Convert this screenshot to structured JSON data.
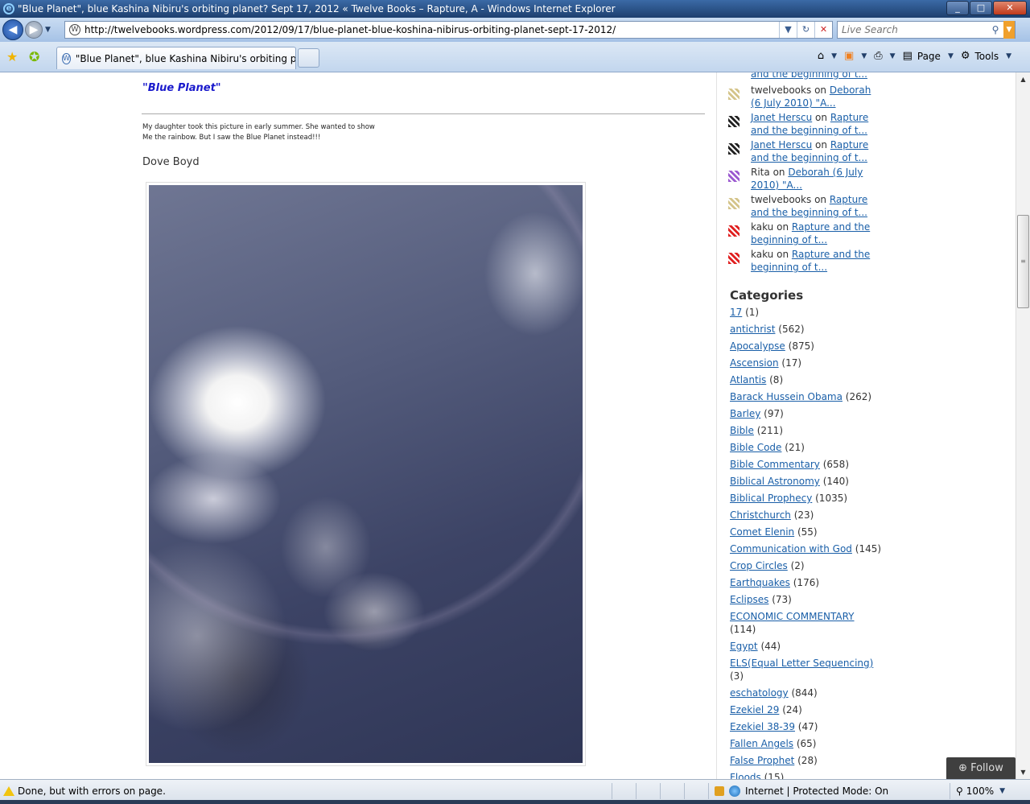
{
  "window": {
    "title": "\"Blue Planet\", blue Kashina Nibiru's orbiting planet? Sept 17, 2012 « Twelve Books – Rapture, A - Windows Internet Explorer",
    "minimize": "_",
    "maximize": "□",
    "close": "✕"
  },
  "nav": {
    "url": "http://twelvebooks.wordpress.com/2012/09/17/blue-planet-blue-koshina-nibirus-orbiting-planet-sept-17-2012/",
    "search_placeholder": "Live Search"
  },
  "tab": {
    "label": "\"Blue Planet\", blue Kashina Nibiru's orbiting plan..."
  },
  "command_bar": {
    "page": "Page",
    "tools": "Tools"
  },
  "post": {
    "title": "\"Blue Planet\"",
    "caption_line1": "My daughter took this picture in early summer.  She wanted to show",
    "caption_line2": "Me the rainbow. But I saw the Blue Planet instead!!!",
    "author": "Dove Boyd"
  },
  "recent_comments": [
    {
      "author": "",
      "on": "",
      "link": "and the beginning of t...",
      "avatar_color": "#d4c48a"
    },
    {
      "author": "twelvebooks",
      "on": "on",
      "link": "Deborah (6 July 2010) \"A...",
      "avatar_color": "#d4c48a"
    },
    {
      "author": "Janet Herscu",
      "on": "on",
      "link": "Rapture and the beginning of t...",
      "avatar_color": "#222222",
      "author_link": true
    },
    {
      "author": "Janet Herscu",
      "on": "on",
      "link": "Rapture and the beginning of t...",
      "avatar_color": "#222222",
      "author_link": true
    },
    {
      "author": "Rita",
      "on": "on",
      "link": "Deborah (6 July 2010) \"A...",
      "avatar_color": "#9b59d0"
    },
    {
      "author": "twelvebooks",
      "on": "on",
      "link": "Rapture and the beginning of t...",
      "avatar_color": "#d4c48a"
    },
    {
      "author": "kaku",
      "on": "on",
      "link": "Rapture and the beginning of t...",
      "avatar_color": "#e02020"
    },
    {
      "author": "kaku",
      "on": "on",
      "link": "Rapture and the beginning of t...",
      "avatar_color": "#e02020"
    }
  ],
  "categories": {
    "heading": "Categories",
    "items": [
      {
        "name": "17",
        "count": "(1)"
      },
      {
        "name": "antichrist",
        "count": "(562)"
      },
      {
        "name": "Apocalypse",
        "count": "(875)"
      },
      {
        "name": "Ascension",
        "count": "(17)"
      },
      {
        "name": "Atlantis",
        "count": "(8)"
      },
      {
        "name": "Barack Hussein Obama",
        "count": "(262)"
      },
      {
        "name": "Barley",
        "count": "(97)"
      },
      {
        "name": "Bible",
        "count": "(211)"
      },
      {
        "name": "Bible Code",
        "count": "(21)"
      },
      {
        "name": "Bible Commentary",
        "count": "(658)"
      },
      {
        "name": "Biblical Astronomy",
        "count": "(140)"
      },
      {
        "name": "Biblical Prophecy",
        "count": "(1035)"
      },
      {
        "name": "Christchurch",
        "count": "(23)"
      },
      {
        "name": "Comet Elenin",
        "count": "(55)"
      },
      {
        "name": "Communication with God",
        "count": "(145)"
      },
      {
        "name": "Crop Circles",
        "count": "(2)"
      },
      {
        "name": "Earthquakes",
        "count": "(176)"
      },
      {
        "name": "Eclipses",
        "count": "(73)"
      },
      {
        "name": "ECONOMIC COMMENTARY",
        "count": "(114)"
      },
      {
        "name": "Egypt",
        "count": "(44)"
      },
      {
        "name": "ELS(Equal Letter Sequencing)",
        "count": "(3)"
      },
      {
        "name": "eschatology",
        "count": "(844)"
      },
      {
        "name": "Ezekiel 29",
        "count": "(24)"
      },
      {
        "name": "Ezekiel 38-39",
        "count": "(47)"
      },
      {
        "name": "Fallen Angels",
        "count": "(65)"
      },
      {
        "name": "False Prophet",
        "count": "(28)"
      },
      {
        "name": "Floods",
        "count": "(15)"
      }
    ]
  },
  "follow": {
    "label": "Follow"
  },
  "status": {
    "text": "Done, but with errors on page.",
    "zone": "Internet | Protected Mode: On",
    "zoom": "100%"
  },
  "colors": {
    "link": "#1a5fa8",
    "post_title": "#1a1acc"
  }
}
